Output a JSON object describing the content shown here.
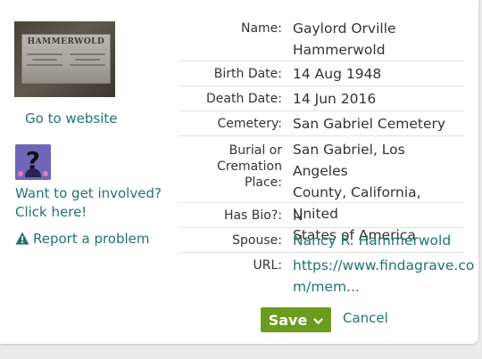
{
  "photo": {
    "headstone_text": "HAMMERWOLD",
    "alt": "headstone photo"
  },
  "left": {
    "goto_website": "Go to website",
    "involved_line1": "Want to get involved?",
    "involved_line2": "Click here!",
    "report_problem": "Report a problem"
  },
  "details": {
    "name_label": "Name:",
    "name_value_line1": "Gaylord Orville",
    "name_value_line2": "Hammerwold",
    "birth_label": "Birth Date:",
    "birth_value": "14 Aug 1948",
    "death_label": "Death Date:",
    "death_value": "14 Jun 2016",
    "cemetery_label": "Cemetery:",
    "cemetery_value": "San Gabriel Cemetery",
    "burial_label_line1": "Burial or",
    "burial_label_line2": "Cremation Place:",
    "burial_value_line1": "San Gabriel, Los Angeles",
    "burial_value_line2": "County, California, United",
    "burial_value_line3": "States of America",
    "bio_label": "Has Bio?:",
    "bio_value": "N",
    "spouse_label": "Spouse:",
    "spouse_value": "Nancy R. Hammerwold",
    "url_label": "URL:",
    "url_value_line1": "https://www.findagrave.co",
    "url_value_line2": "m/mem..."
  },
  "actions": {
    "save_label": "Save",
    "cancel_label": "Cancel"
  },
  "colors": {
    "link": "#22746e",
    "save_button": "#6c9b1d",
    "background": "#ececec"
  },
  "icons": {
    "report": "warning-triangle-icon",
    "save_dropdown": "chevron-down-icon",
    "involved": "question-mark-icon"
  }
}
